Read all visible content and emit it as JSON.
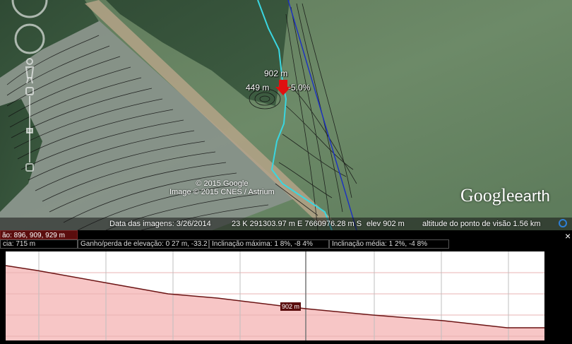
{
  "map": {
    "point_label": "902 m",
    "distance_label": "449 m",
    "slope_label": "-5.0%",
    "credit_line1": "© 2015 Google",
    "credit_line2": "Image © 2015 CNES / Astrium",
    "brand_google": "Google",
    "brand_earth": "earth"
  },
  "status_bar": {
    "imagery_date": "Data das imagens: 3/26/2014",
    "coordinates": "23 K 291303.97 m E 7660976.28 m S",
    "elevation": "elev  902 m",
    "eye_altitude": "altitude do ponto de visão  1.56 km"
  },
  "profile": {
    "range_label": "ão: 896, 909, 929 m",
    "stats": {
      "distance": "cia: 715 m",
      "gain_loss": "Ganho/perda de elevação: 0 27 m, -33.2 m",
      "max_slope": "Inclinação máxima: 1 8%, -8 4%",
      "avg_slope": "Inclinação média: 1 2%, -4 8%"
    },
    "marker_label": "902 m",
    "close_glyph": "×"
  },
  "colors": {
    "path": "#3ad6e0",
    "line_blue": "#1a2fc4",
    "profile_line": "#6b1414",
    "profile_fill": "#f7c6c6",
    "marker_bg": "#5a0d0d",
    "pin": "#e01010"
  },
  "icons": {
    "pin": "pointer-arrow-icon",
    "nav": "navigation-controls-icon",
    "close": "close-icon"
  }
}
